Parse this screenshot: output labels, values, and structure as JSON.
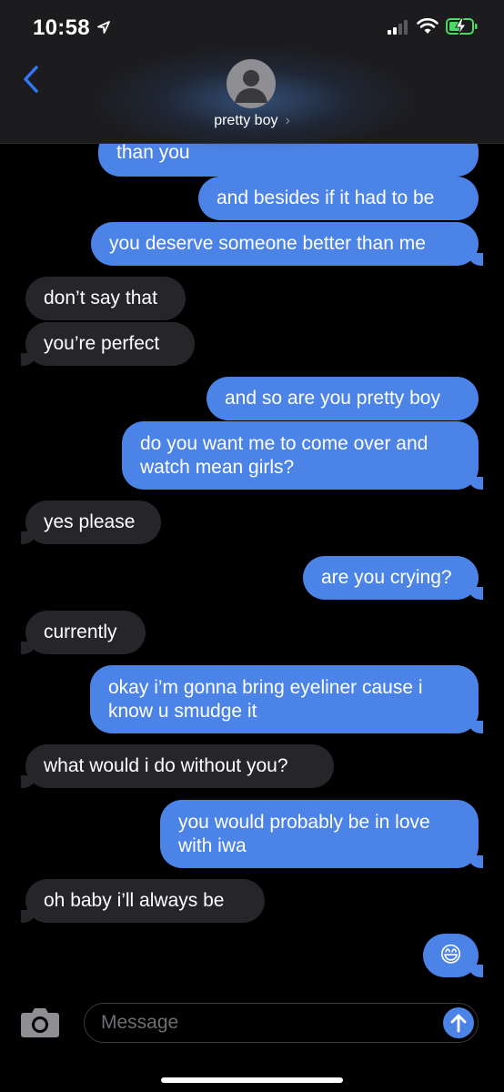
{
  "status_bar": {
    "time": "10:58"
  },
  "header": {
    "contact_name": "pretty boy",
    "chevron": "›"
  },
  "messages": [
    {
      "sender": "me",
      "text": "than you"
    },
    {
      "sender": "me",
      "text": "and besides if it had to be"
    },
    {
      "sender": "me",
      "text": "you deserve someone better than me"
    },
    {
      "sender": "them",
      "text": "don’t say that"
    },
    {
      "sender": "them",
      "text": "you’re perfect"
    },
    {
      "sender": "me",
      "text": "and so are you pretty boy"
    },
    {
      "sender": "me",
      "lines": [
        "do you want me to come over and",
        "watch mean girls?"
      ]
    },
    {
      "sender": "them",
      "text": "yes please"
    },
    {
      "sender": "me",
      "text": "are you crying?"
    },
    {
      "sender": "them",
      "text": "currently"
    },
    {
      "sender": "me",
      "lines": [
        "okay i’m gonna bring eyeliner cause i",
        "know u smudge it"
      ]
    },
    {
      "sender": "them",
      "text": "what would i do without you?"
    },
    {
      "sender": "me",
      "lines": [
        "you would probably be in love",
        "with iwa"
      ]
    },
    {
      "sender": "them",
      "text": "oh baby i’ll always be"
    },
    {
      "sender": "me",
      "text": "😄"
    }
  ],
  "composer": {
    "placeholder": "Message"
  },
  "icons": {
    "back": "chevron-left-icon",
    "location": "location-arrow-icon",
    "signal": "cellular-signal-icon",
    "wifi": "wifi-icon",
    "battery": "battery-charging-icon",
    "camera": "camera-icon",
    "send": "arrow-up-icon"
  },
  "colors": {
    "sent_bubble": "#4c83e6",
    "received_bubble": "#26262a",
    "accent": "#3478f6",
    "battery": "#4cd964"
  }
}
